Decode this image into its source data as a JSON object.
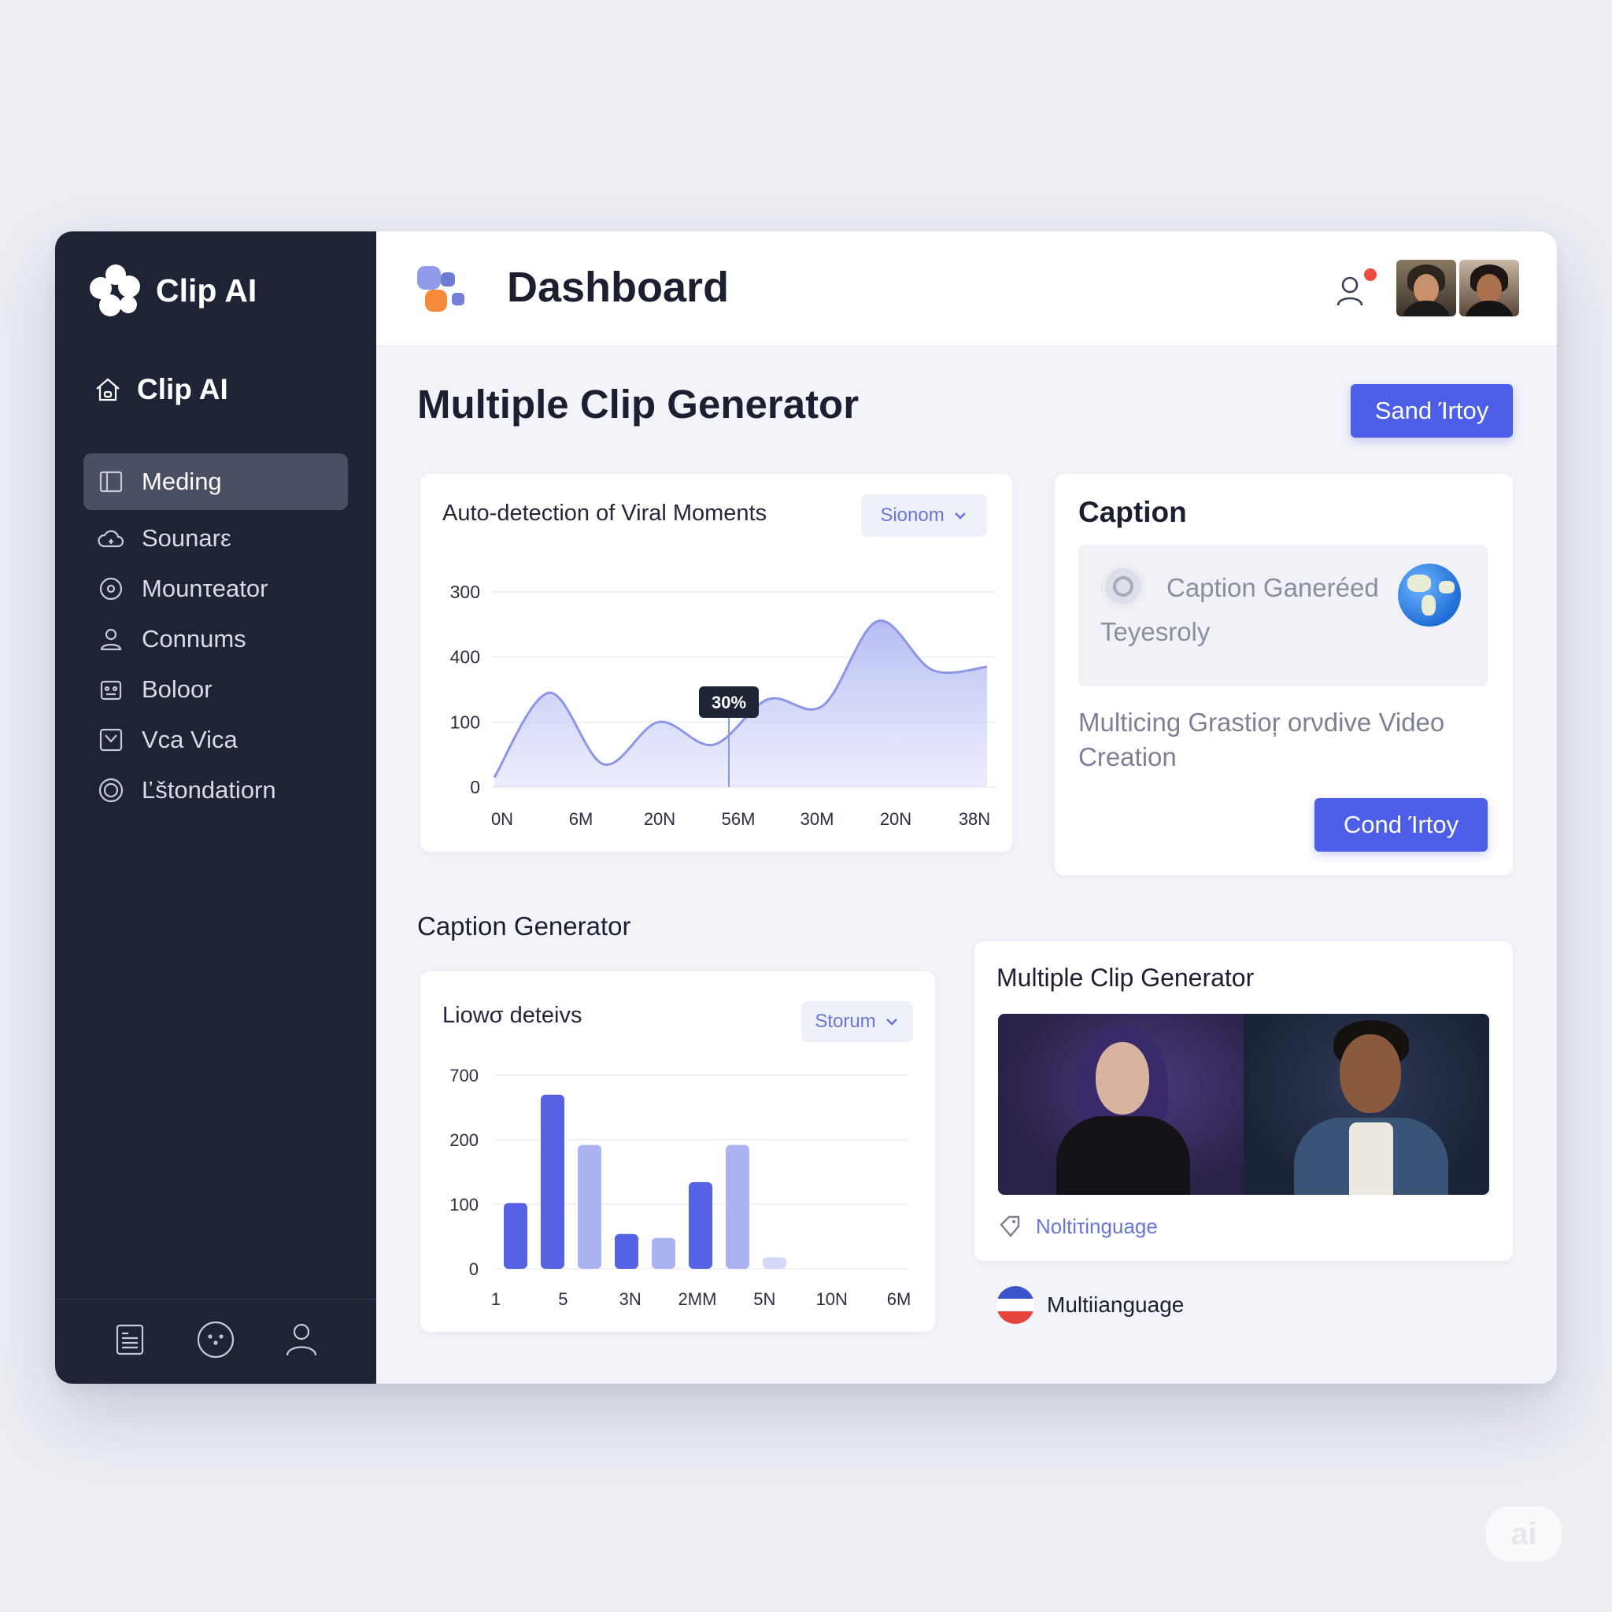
{
  "app": {
    "name": "Clip AI"
  },
  "sidebar": {
    "home_label": "Clip AI",
    "items": [
      {
        "label": "Meding",
        "icon": "book-icon",
        "active": true
      },
      {
        "label": "Sounarε",
        "icon": "cloud-icon"
      },
      {
        "label": "Mounτeator",
        "icon": "disc-icon"
      },
      {
        "label": "Connums",
        "icon": "users-icon"
      },
      {
        "label": "Boloor",
        "icon": "robot-icon"
      },
      {
        "label": "Vca Vica",
        "icon": "checkbox-icon"
      },
      {
        "label": "Ľštondatiorn",
        "icon": "target-icon"
      }
    ],
    "footer_icons": [
      "document-icon",
      "emoji-icon",
      "profile-icon"
    ]
  },
  "header": {
    "title": "Dashboard",
    "notification_color": "#ef4b3f"
  },
  "main": {
    "section_title": "Multiple Clip Generator",
    "primary_button": "Sand Ίrtoy",
    "viral_card": {
      "title": "Auto-detection of Viral Moments",
      "dropdown": "Sionom"
    },
    "caption_card": {
      "title": "Caption",
      "status": "Caption Ganeréed",
      "sub": "Teyesroly",
      "description": "Multicing Grastioŗ orνdive Video Creation",
      "button": "Cond Ίrtoy"
    },
    "caption_generator_title": "Caption Generator",
    "bar_card": {
      "title": "Liowσ deteivs",
      "dropdown": "Storum"
    },
    "clip_card": {
      "title": "Multiple Clip Generator",
      "tag": "Noltiτinguage"
    },
    "language_label": "Multiianguage"
  },
  "chart_data": [
    {
      "type": "area",
      "title": "Auto-detection of Viral Moments",
      "y_tick_labels": [
        "0",
        "100",
        "400",
        "300"
      ],
      "x_tick_labels": [
        "0N",
        "6M",
        "20N",
        "56M",
        "30M",
        "20N",
        "38N"
      ],
      "values": [
        0.15,
        1.45,
        0.35,
        1.0,
        0.65,
        1.35,
        1.25,
        2.55,
        1.8,
        1.85
      ],
      "annotation": "30%",
      "color": "#8b96e6"
    },
    {
      "type": "bar",
      "title": "Liowσ deteivs",
      "y_tick_labels": [
        "0",
        "100",
        "200",
        "700"
      ],
      "x_tick_labels": [
        "1",
        "5",
        "3N",
        "2ΜΜ",
        "5N",
        "10N",
        "6M"
      ],
      "values": [
        85,
        225,
        160,
        45,
        40,
        112,
        160,
        15
      ],
      "colors": [
        "#5562e3",
        "#5562e3",
        "#aab2f0",
        "#5562e3",
        "#aab2f0",
        "#5562e3",
        "#aab2f0",
        "#d5d9f6"
      ]
    }
  ]
}
